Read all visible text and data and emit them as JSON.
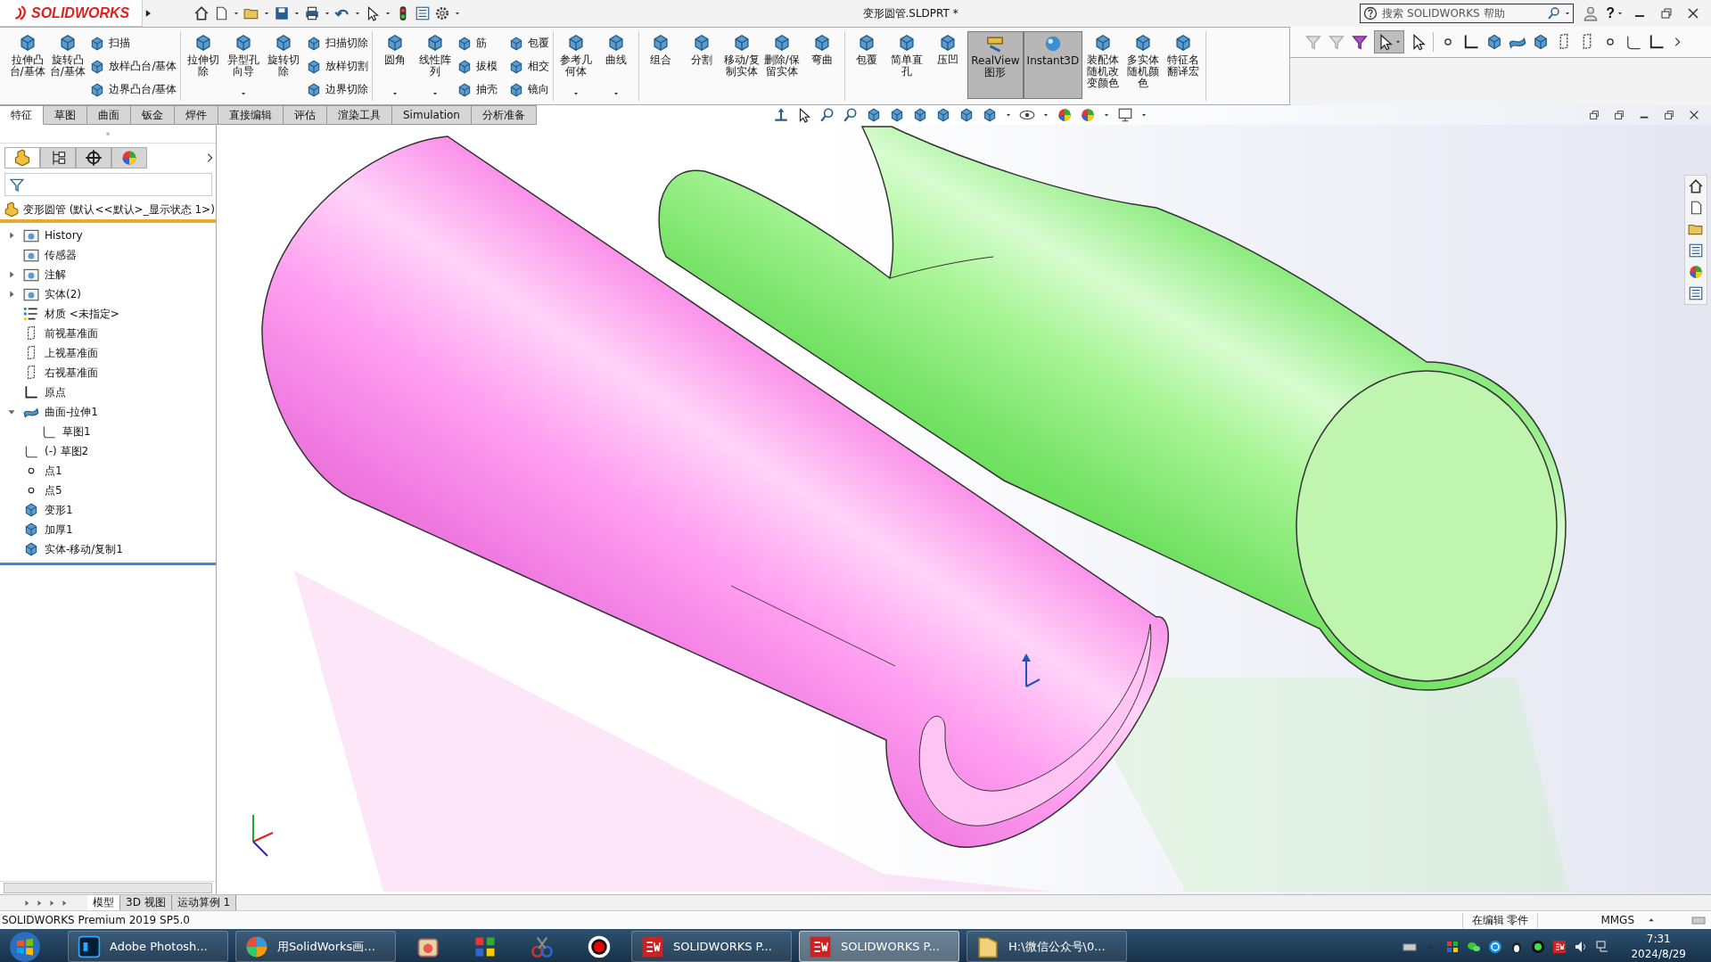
{
  "title_bar": {
    "logo": "SOLIDWORKS",
    "document_title": "变形圆管.SLDPRT *",
    "search": {
      "placeholder": "搜索 SOLIDWORKS 帮助"
    },
    "help_button": "?"
  },
  "command_manager": {
    "groups": [
      [
        {
          "kind": "large",
          "label": "拉伸凸台/基体",
          "dropdown": false,
          "on": false
        },
        {
          "kind": "large",
          "label": "旋转凸台/基体",
          "dropdown": false,
          "on": false
        },
        {
          "kind": "stack",
          "items": [
            "扫描",
            "放样凸台/基体",
            "边界凸台/基体"
          ]
        }
      ],
      [
        {
          "kind": "large",
          "label": "拉伸切除",
          "dropdown": false,
          "on": false
        },
        {
          "kind": "large",
          "label": "异型孔向导",
          "dropdown": true,
          "on": false
        },
        {
          "kind": "large",
          "label": "旋转切除",
          "dropdown": false,
          "on": false
        },
        {
          "kind": "stack",
          "items": [
            "扫描切除",
            "放样切割",
            "边界切除"
          ]
        }
      ],
      [
        {
          "kind": "large",
          "label": "圆角",
          "dropdown": true,
          "on": false
        },
        {
          "kind": "large",
          "label": "线性阵列",
          "dropdown": true,
          "on": false
        },
        {
          "kind": "stack",
          "items": [
            "筋",
            "拔模",
            "抽壳"
          ]
        },
        {
          "kind": "stack",
          "items": [
            "包覆",
            "相交",
            "镜向"
          ]
        }
      ],
      [
        {
          "kind": "large",
          "label": "参考几何体",
          "dropdown": true,
          "on": false
        },
        {
          "kind": "large",
          "label": "曲线",
          "dropdown": true,
          "on": false
        }
      ],
      [
        {
          "kind": "large",
          "label": "组合",
          "dropdown": false,
          "on": false
        },
        {
          "kind": "large",
          "label": "分割",
          "dropdown": false,
          "on": false
        },
        {
          "kind": "large",
          "label": "移动/复制实体",
          "dropdown": false,
          "on": false
        },
        {
          "kind": "large",
          "label": "删除/保留实体",
          "dropdown": false,
          "on": false
        },
        {
          "kind": "large",
          "label": "弯曲",
          "dropdown": false,
          "on": false
        }
      ],
      [
        {
          "kind": "large",
          "label": "包覆",
          "dropdown": false,
          "on": false
        },
        {
          "kind": "large",
          "label": "简单直孔",
          "dropdown": false,
          "on": false
        },
        {
          "kind": "large",
          "label": "压凹",
          "dropdown": false,
          "on": false
        },
        {
          "kind": "large",
          "label": "RealView图形",
          "dropdown": false,
          "on": true
        },
        {
          "kind": "large",
          "label": "Instant3D",
          "dropdown": false,
          "on": true
        },
        {
          "kind": "large",
          "label": "装配体随机改变颜色",
          "dropdown": false,
          "on": false
        },
        {
          "kind": "large",
          "label": "多实体随机颜色",
          "dropdown": false,
          "on": false
        },
        {
          "kind": "large",
          "label": "特征名翻译宏",
          "dropdown": false,
          "on": false
        }
      ]
    ]
  },
  "feature_tabs": [
    {
      "label": "特征",
      "selected": true
    },
    {
      "label": "草图",
      "selected": false
    },
    {
      "label": "曲面",
      "selected": false
    },
    {
      "label": "钣金",
      "selected": false
    },
    {
      "label": "焊件",
      "selected": false
    },
    {
      "label": "直接编辑",
      "selected": false
    },
    {
      "label": "评估",
      "selected": false
    },
    {
      "label": "渲染工具",
      "selected": false
    },
    {
      "label": "Simulation",
      "selected": false
    },
    {
      "label": "分析准备",
      "selected": false
    }
  ],
  "feature_tree": {
    "panel_tabs": [
      {
        "selected": true
      },
      {
        "selected": false
      },
      {
        "selected": false
      },
      {
        "selected": false
      }
    ],
    "root": "变形圆管 (默认<<默认>_显示状态 1>)",
    "items": [
      {
        "kind": "folder",
        "label": "History",
        "expanded": false
      },
      {
        "kind": "folder",
        "label": "传感器"
      },
      {
        "kind": "folder",
        "label": "注解",
        "expanded": false
      },
      {
        "kind": "folder",
        "label": "实体(2)",
        "expanded": false
      },
      {
        "kind": "material",
        "label": "材质 <未指定>"
      },
      {
        "kind": "plane",
        "label": "前视基准面"
      },
      {
        "kind": "plane",
        "label": "上视基准面"
      },
      {
        "kind": "plane",
        "label": "右视基准面"
      },
      {
        "kind": "origin",
        "label": "原点"
      },
      {
        "kind": "surface",
        "label": "曲面-拉伸1",
        "expanded": true,
        "children": [
          {
            "kind": "sketch",
            "label": "草图1"
          }
        ]
      },
      {
        "kind": "sketch",
        "label": "(-) 草图2"
      },
      {
        "kind": "point",
        "label": "点1"
      },
      {
        "kind": "point",
        "label": "点5"
      },
      {
        "kind": "feature",
        "label": "变形1"
      },
      {
        "kind": "feature",
        "label": "加厚1"
      },
      {
        "kind": "feature",
        "label": "实体-移动/复制1"
      }
    ]
  },
  "model_tabs": [
    {
      "label": "模型",
      "selected": true
    },
    {
      "label": "3D 视图",
      "selected": false
    },
    {
      "label": "运动算例 1",
      "selected": false
    }
  ],
  "status_bar": {
    "product": "SOLIDWORKS Premium 2019 SP5.0",
    "mode": "在编辑 零件",
    "units": "MMGS"
  },
  "taskbar": {
    "items": [
      {
        "kind": "app",
        "label": "Adobe Photosh...",
        "selected": false
      },
      {
        "kind": "app",
        "label": "用SolidWorks画...",
        "selected": false
      },
      {
        "kind": "icon",
        "selected": false
      },
      {
        "kind": "icon",
        "selected": false
      },
      {
        "kind": "icon",
        "selected": false
      },
      {
        "kind": "icon",
        "selected": false
      },
      {
        "kind": "app",
        "label": "SOLIDWORKS P...",
        "selected": false
      },
      {
        "kind": "app",
        "label": "SOLIDWORKS P...",
        "selected": true
      },
      {
        "kind": "app",
        "label": "H:\\微信公众号\\0...",
        "selected": false
      }
    ],
    "time": "7:31",
    "date": "2024/8/29"
  }
}
